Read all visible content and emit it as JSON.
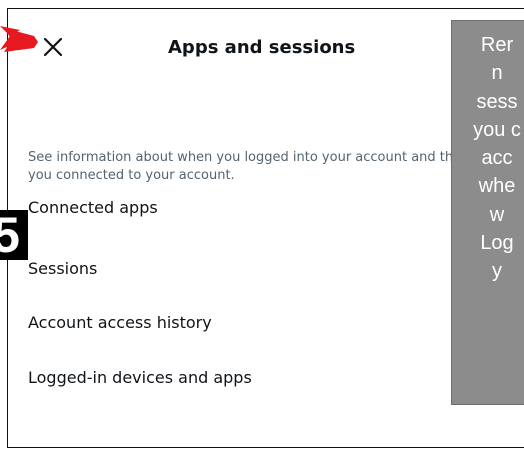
{
  "header": {
    "title": "Apps and sessions",
    "close_icon": "close-icon"
  },
  "main": {
    "description_lines": [
      "See information about when you logged into your account and th",
      "you connected to your account."
    ],
    "menu_items": [
      {
        "label": "Connected apps"
      },
      {
        "label": "Sessions"
      },
      {
        "label": "Account access history"
      },
      {
        "label": "Logged-in devices and apps"
      }
    ]
  },
  "annotation": {
    "step_number": "5",
    "arrow_color": "#e5191f",
    "arrow_icon": "red-arrow-icon",
    "panel_lines": [
      "Rer",
      "n",
      "sess",
      "you c",
      "acc",
      "whe",
      "w",
      "Log",
      "y"
    ]
  }
}
